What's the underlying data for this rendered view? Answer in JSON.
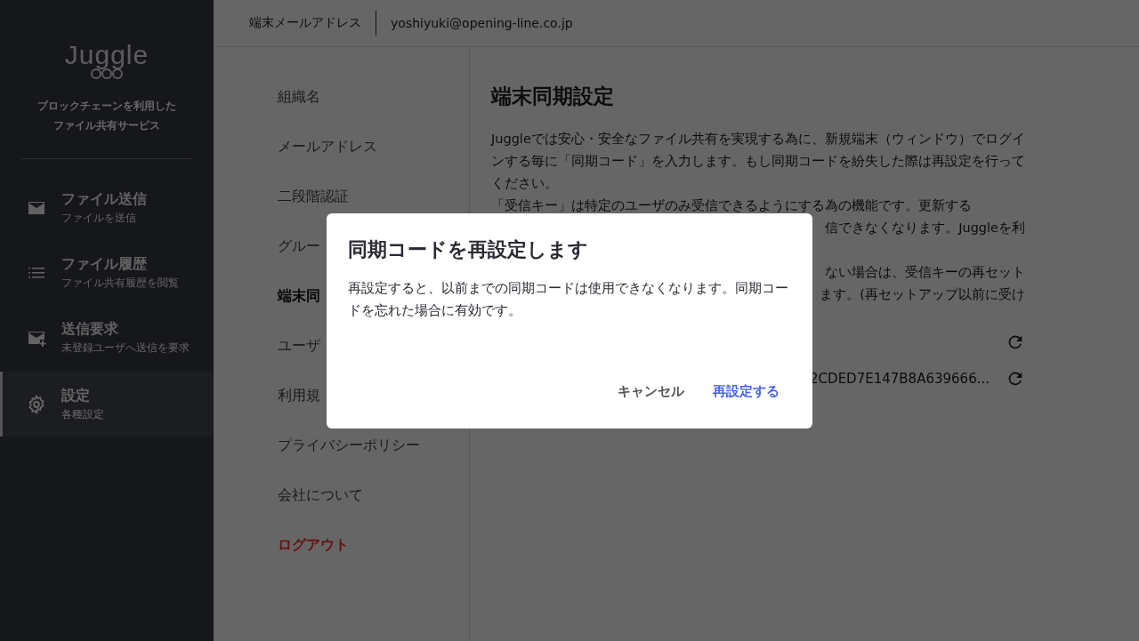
{
  "sidebar": {
    "logo": "Juggle",
    "tagline": [
      "ブロックチェーンを利用した",
      "ファイル共有サービス"
    ],
    "items": [
      {
        "kind": "mail",
        "label": "ファイル送信",
        "sub": "ファイルを送信",
        "selected": false
      },
      {
        "kind": "list",
        "label": "ファイル履歴",
        "sub": "ファイル共有履歴を閲覧",
        "selected": false
      },
      {
        "kind": "mail-plus",
        "label": "送信要求",
        "sub": "未登録ユーザへ送信を要求",
        "selected": false
      },
      {
        "kind": "gear",
        "label": "設定",
        "sub": "各種設定",
        "selected": true
      }
    ]
  },
  "topbar": {
    "label": "端末メールアドレス",
    "email": "yoshiyuki@opening-line.co.jp"
  },
  "settings_menu": [
    {
      "label": "組織名",
      "selected": false,
      "kind": "normal"
    },
    {
      "label": "メールアドレス",
      "selected": false,
      "kind": "normal"
    },
    {
      "label": "二段階認証",
      "selected": false,
      "kind": "normal"
    },
    {
      "label": "グルー",
      "selected": false,
      "kind": "normal"
    },
    {
      "label": "端末同",
      "selected": true,
      "kind": "normal"
    },
    {
      "label": "ユーザ",
      "selected": false,
      "kind": "normal"
    },
    {
      "label": "利用規",
      "selected": false,
      "kind": "normal"
    },
    {
      "label": "プライバシーポリシー",
      "selected": false,
      "kind": "normal"
    },
    {
      "label": "会社について",
      "selected": false,
      "kind": "normal"
    },
    {
      "label": "ログアウト",
      "selected": false,
      "kind": "danger"
    }
  ],
  "content": {
    "title": "端末同期設定",
    "paragraph": "Juggleでは安心・安全なファイル共有を実現する為に、新規端末（ウィンドウ）でログインする毎に「同期コード」を入力します。もし同期コードを紛失した際は再設定を行ってください。",
    "paragraph_2": "「受信キー」は特定のユーザのみ受信できるようにする為の機能です。更新する",
    "fragments": [
      "信できなくなります。Juggleを利",
      "ない場合は、受信キーの再セット",
      "ます。(再セットアップ以前に受け"
    ],
    "rows": [
      {
        "kind": "icon_only"
      },
      {
        "kind": "value",
        "value": "2CDED7E147B8A639666..."
      }
    ]
  },
  "dialog": {
    "title": "同期コードを再設定します",
    "body": "再設定すると、以前までの同期コードは使用できなくなります。同期コードを忘れた場合に有効です。",
    "cancel": "キャンセル",
    "confirm": "再設定する"
  }
}
